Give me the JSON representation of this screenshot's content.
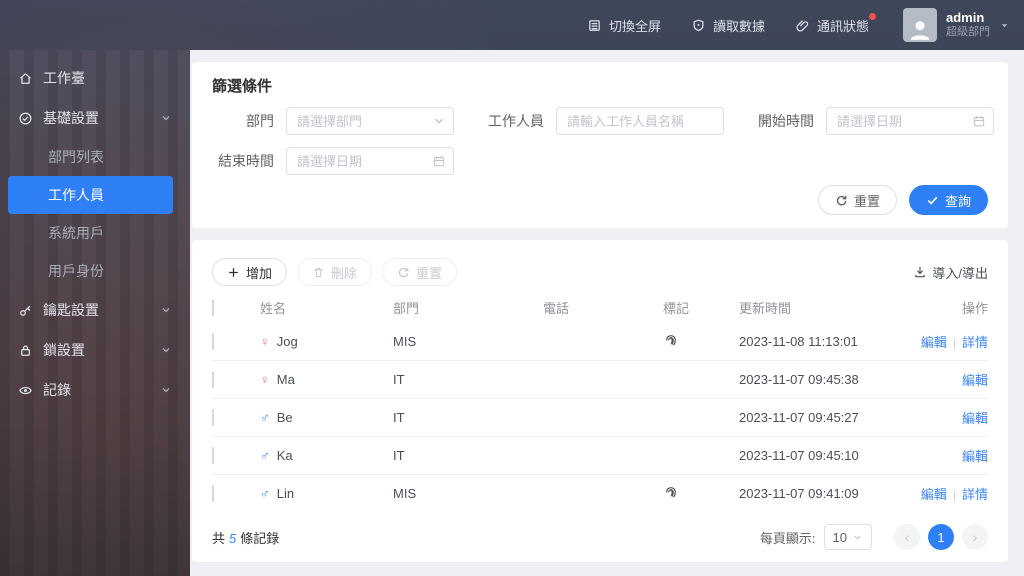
{
  "colors": {
    "accent": "#2f80f7",
    "link": "#3c86f6",
    "female": "#f06ba0",
    "male": "#3f86f5",
    "badge": "#f04f4f"
  },
  "topbar": {
    "fullscreen": "切換全屏",
    "read_data": "讀取數據",
    "comm_status": "通訊狀態",
    "user_name": "admin",
    "user_dept": "超級部門"
  },
  "sidebar": {
    "workbench": "工作臺",
    "basic_settings": "基礎設置",
    "sub_items": [
      "部門列表",
      "工作人員",
      "系統用戶",
      "用戶身份"
    ],
    "active_sub": "工作人員",
    "key_settings": "鑰匙設置",
    "lock_settings": "鎖設置",
    "records": "記錄"
  },
  "filter": {
    "title": "篩選條件",
    "department_label": "部門",
    "department_placeholder": "請選擇部門",
    "staff_label": "工作人員",
    "staff_placeholder": "請輸入工作人員名稱",
    "start_label": "開始時間",
    "start_placeholder": "請選擇日期",
    "end_label": "結束時間",
    "end_placeholder": "請選擇日期",
    "reset_label": "重置",
    "query_label": "查詢"
  },
  "table": {
    "add_label": "增加",
    "delete_label": "刪除",
    "reset_label": "重置",
    "import_export_label": "導入/導出",
    "columns": {
      "name": "姓名",
      "dept": "部門",
      "phone": "電話",
      "mark": "標記",
      "updated": "更新時間",
      "actions": "操作"
    },
    "gender_symbols": {
      "female": "♀",
      "male": "♂"
    },
    "rows": [
      {
        "name": "Jog",
        "gender": "female",
        "department": "MIS",
        "phone": "",
        "marked": true,
        "updated": "2023-11-08 11:13:01",
        "actions": [
          "編輯",
          "詳情"
        ]
      },
      {
        "name": "Ma",
        "gender": "female",
        "department": "IT",
        "phone": "",
        "marked": false,
        "updated": "2023-11-07 09:45:38",
        "actions": [
          "編輯"
        ]
      },
      {
        "name": "Be",
        "gender": "male",
        "department": "IT",
        "phone": "",
        "marked": false,
        "updated": "2023-11-07 09:45:27",
        "actions": [
          "編輯"
        ]
      },
      {
        "name": "Ka",
        "gender": "male",
        "department": "IT",
        "phone": "",
        "marked": false,
        "updated": "2023-11-07 09:45:10",
        "actions": [
          "編輯"
        ]
      },
      {
        "name": "Lin",
        "gender": "male",
        "department": "MIS",
        "phone": "",
        "marked": true,
        "updated": "2023-11-07 09:41:09",
        "actions": [
          "編輯",
          "詳情"
        ]
      }
    ],
    "footer": {
      "total_prefix": "共",
      "total_count": "5",
      "total_suffix": "條記錄",
      "page_size_label": "每頁顯示:",
      "page_size": "10",
      "current_page": "1",
      "prev": "‹",
      "next": "›"
    }
  }
}
